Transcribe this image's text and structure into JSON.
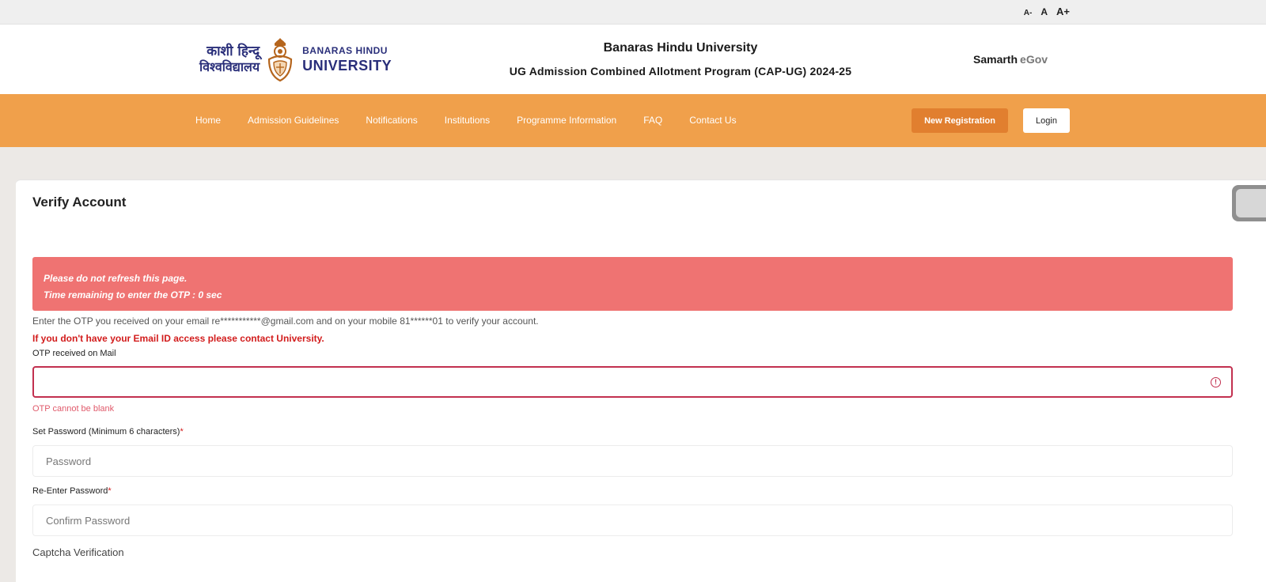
{
  "font_controls": {
    "decrease": "A-",
    "normal": "A",
    "increase": "A+"
  },
  "logo": {
    "hindi_line1": "काशी हिन्दू",
    "hindi_line2": "विश्वविद्यालय",
    "english_line1": "BANARAS HINDU",
    "english_line2": "UNIVERSITY"
  },
  "header": {
    "title": "Banaras Hindu University",
    "subtitle": "UG Admission Combined Allotment Program (CAP-UG) 2024-25",
    "brand_part1": "Samarth",
    "brand_part2": "eGov"
  },
  "nav": {
    "items": [
      {
        "label": "Home"
      },
      {
        "label": "Admission Guidelines"
      },
      {
        "label": "Notifications"
      },
      {
        "label": "Institutions"
      },
      {
        "label": "Programme Information"
      },
      {
        "label": "FAQ"
      },
      {
        "label": "Contact Us"
      }
    ],
    "new_registration": "New Registration",
    "login": "Login"
  },
  "form": {
    "title": "Verify Account",
    "alert_line1": "Please do not refresh this page.",
    "alert_line2": "Time remaining to enter the OTP : 0 sec",
    "info": "Enter the OTP you received on your email re***********@gmail.com and on your mobile 81******01 to verify your account.",
    "warning": "If you don't have your Email ID access please contact University.",
    "otp_label": "OTP received on Mail",
    "otp_value": "",
    "otp_error": "OTP cannot be blank",
    "password_label": "Set Password (Minimum 6 characters)",
    "password_placeholder": "Password",
    "confirm_label": "Re-Enter Password",
    "confirm_placeholder": "Confirm Password",
    "required_mark": "*",
    "captcha_label": "Captcha Verification"
  },
  "colors": {
    "nav_bg": "#f0a04b",
    "primary_button": "#e17f2f",
    "alert_bg": "#ef7372",
    "error": "#c2304f",
    "brand_blue": "#2a2f7a"
  }
}
